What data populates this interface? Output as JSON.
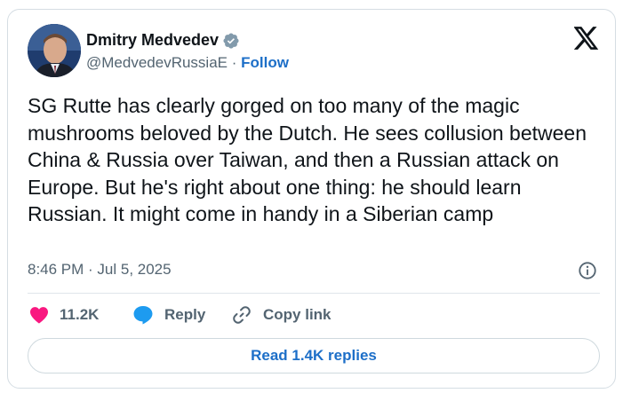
{
  "author": {
    "name": "Dmitry Medvedev",
    "handle": "@MedvedevRussiaE",
    "separator": "·",
    "follow_label": "Follow",
    "verified_icon": "verified-badge-icon"
  },
  "tweet": {
    "text": "SG Rutte has clearly gorged on too many of the magic mushrooms beloved by the Dutch. He sees collusion between China & Russia over Taiwan, and then a Russian attack on Europe. But he's right about one thing: he should learn Russian. It might come in handy in a Siberian camp",
    "timestamp": "8:46 PM · Jul 5, 2025"
  },
  "actions": {
    "like_count": "11.2K",
    "reply_label": "Reply",
    "copy_link_label": "Copy link"
  },
  "read_replies_label": "Read 1.4K replies",
  "colors": {
    "text": "#0f1419",
    "secondary": "#536471",
    "link": "#1d6fc8",
    "like": "#f91880",
    "reply": "#1d9bf0",
    "verified": "#829aab"
  }
}
